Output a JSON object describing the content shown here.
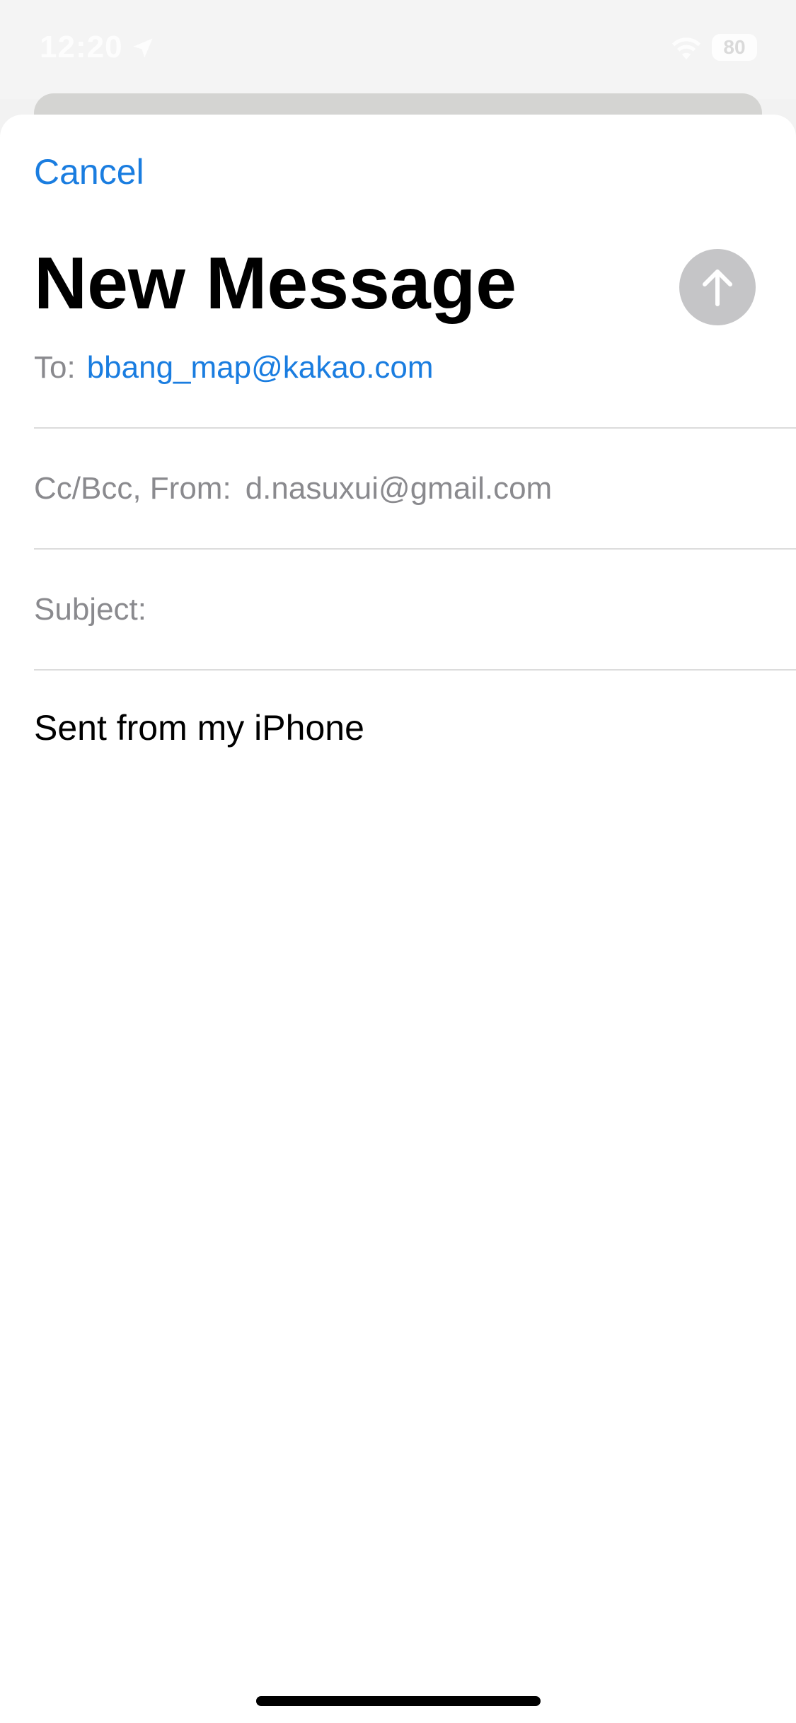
{
  "status_bar": {
    "time": "12:20",
    "battery": "80"
  },
  "compose": {
    "cancel_label": "Cancel",
    "title": "New Message"
  },
  "fields": {
    "to_label": "To:",
    "to_value": "bbang_map@kakao.com",
    "ccbcc_label": "Cc/Bcc, From:",
    "from_value": "d.nasuxui@gmail.com",
    "subject_label": "Subject:",
    "subject_value": ""
  },
  "body": {
    "signature": "Sent from my iPhone"
  },
  "colors": {
    "accent": "#1a7de0",
    "send_button_disabled": "#c5c5c7"
  },
  "icons": {
    "send": "arrow-up-icon",
    "location": "location-arrow-icon",
    "wifi": "wifi-icon"
  }
}
